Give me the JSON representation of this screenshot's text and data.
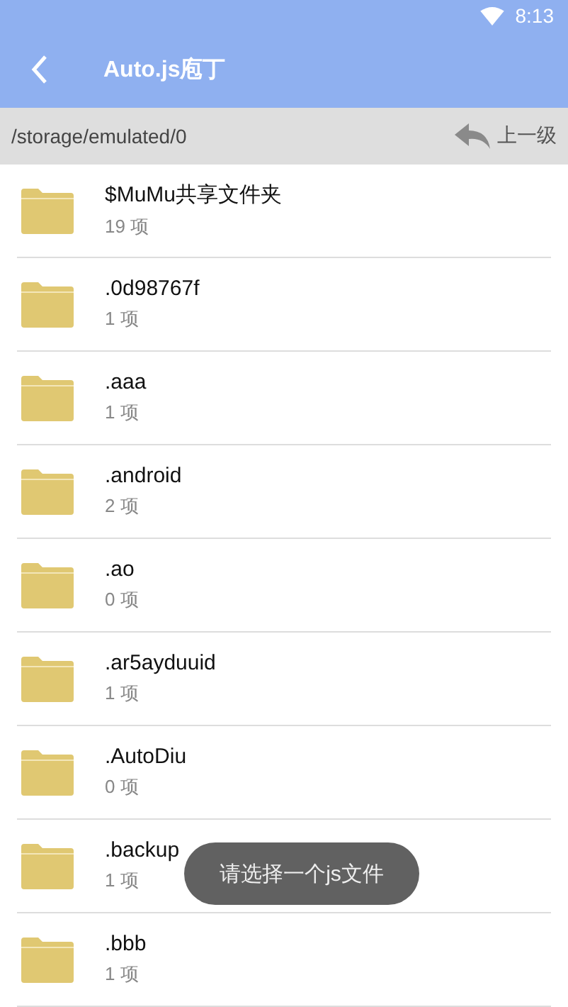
{
  "status_bar": {
    "time": "8:13"
  },
  "app_bar": {
    "title": "Auto.js庖丁"
  },
  "path_bar": {
    "path": "/storage/emulated/0",
    "up_label": "上一级"
  },
  "files": [
    {
      "name": "$MuMu共享文件夹",
      "count": "19 项"
    },
    {
      "name": ".0d98767f",
      "count": "1 项"
    },
    {
      "name": ".aaa",
      "count": "1 项"
    },
    {
      "name": ".android",
      "count": "2 项"
    },
    {
      "name": ".ao",
      "count": "0 项"
    },
    {
      "name": ".ar5ayduuid",
      "count": "1 项"
    },
    {
      "name": ".AutoDiu",
      "count": "0 项"
    },
    {
      "name": ".backup",
      "count": "1 项"
    },
    {
      "name": ".bbb",
      "count": "1 项"
    }
  ],
  "toast": "请选择一个js文件"
}
